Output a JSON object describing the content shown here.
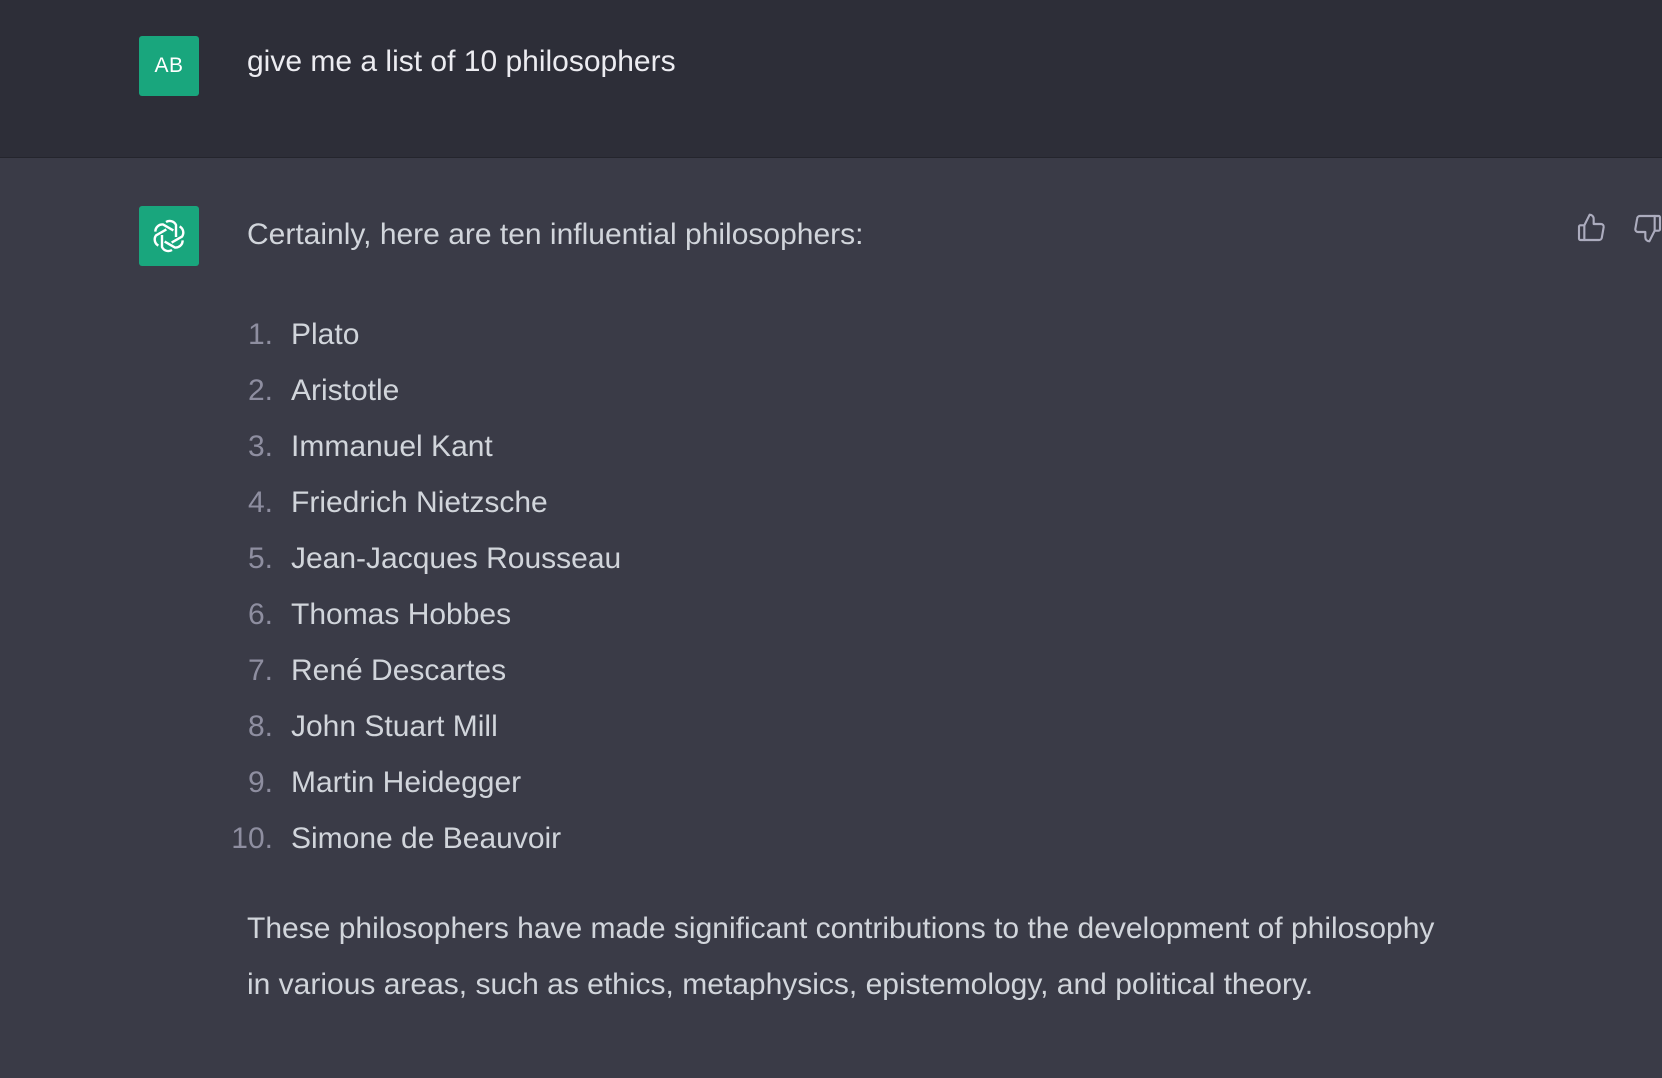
{
  "user_message": {
    "avatar_initials": "AB",
    "avatar_color": "#19a67d",
    "text": "give me a list of 10 philosophers"
  },
  "assistant_message": {
    "avatar_icon": "openai-logo-icon",
    "avatar_color": "#19a67d",
    "intro": "Certainly, here are ten influential philosophers:",
    "items": [
      {
        "num": "1.",
        "name": "Plato"
      },
      {
        "num": "2.",
        "name": "Aristotle"
      },
      {
        "num": "3.",
        "name": "Immanuel Kant"
      },
      {
        "num": "4.",
        "name": "Friedrich Nietzsche"
      },
      {
        "num": "5.",
        "name": "Jean-Jacques Rousseau"
      },
      {
        "num": "6.",
        "name": "Thomas Hobbes"
      },
      {
        "num": "7.",
        "name": "René Descartes"
      },
      {
        "num": "8.",
        "name": "John Stuart Mill"
      },
      {
        "num": "9.",
        "name": "Martin Heidegger"
      },
      {
        "num": "10.",
        "name": "Simone de Beauvoir"
      }
    ],
    "conclusion_line1": "These philosophers have made significant contributions to the development of philosophy",
    "conclusion_line2": "in various areas, such as ethics, metaphysics, epistemology, and political theory.",
    "feedback_icons": [
      "thumbs-up-icon",
      "thumbs-down-icon"
    ]
  }
}
